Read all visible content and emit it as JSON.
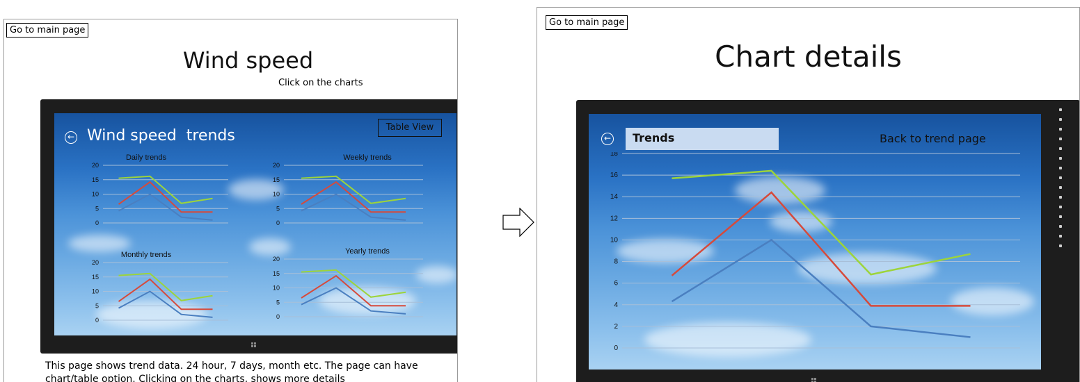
{
  "left": {
    "goto_label": "Go to main page",
    "title": "Wind speed",
    "subtitle": "Click on the charts",
    "app_title": "Wind speed  trends",
    "table_view_label": "Table View",
    "description": "This page shows trend data. 24 hour, 7 days, month etc. The page can have chart/table option. Clicking on the charts, shows more details"
  },
  "right": {
    "goto_label": "Go to main page",
    "title": "Chart details",
    "trends_label": "Trends",
    "back_link_label": "Back to trend page"
  },
  "colors": {
    "green": "#9dd43a",
    "red": "#d64a3b",
    "blue": "#4a7fc0",
    "grid": "#a8bfd8",
    "axis_text": "#111111"
  },
  "icons": [
    "back-arrow-icon",
    "right-arrow-icon",
    "windows-logo-icon"
  ],
  "chart_data": [
    {
      "type": "line",
      "title": "Daily trends",
      "x": [
        1,
        2,
        3,
        4
      ],
      "ylim": [
        0,
        20
      ],
      "yticks": [
        0,
        5,
        10,
        15,
        20
      ],
      "series": [
        {
          "color": "green",
          "values": [
            15.5,
            16.2,
            6.8,
            8.5
          ]
        },
        {
          "color": "red",
          "values": [
            6.5,
            14.2,
            3.8,
            3.8
          ]
        },
        {
          "color": "blue",
          "values": [
            4.2,
            10,
            2,
            1
          ]
        }
      ]
    },
    {
      "type": "line",
      "title": "Weekly trends",
      "x": [
        1,
        2,
        3,
        4
      ],
      "ylim": [
        0,
        20
      ],
      "yticks": [
        0,
        5,
        10,
        15,
        20
      ],
      "series": [
        {
          "color": "green",
          "values": [
            15.5,
            16.2,
            6.8,
            8.5
          ]
        },
        {
          "color": "red",
          "values": [
            6.5,
            14.2,
            3.8,
            3.8
          ]
        },
        {
          "color": "blue",
          "values": [
            4.2,
            10,
            2,
            1
          ]
        }
      ]
    },
    {
      "type": "line",
      "title": "Monthly trends",
      "x": [
        1,
        2,
        3,
        4
      ],
      "ylim": [
        0,
        20
      ],
      "yticks": [
        0,
        5,
        10,
        15,
        20
      ],
      "series": [
        {
          "color": "green",
          "values": [
            15.5,
            16.2,
            6.8,
            8.5
          ]
        },
        {
          "color": "red",
          "values": [
            6.5,
            14.2,
            3.8,
            3.8
          ]
        },
        {
          "color": "blue",
          "values": [
            4.2,
            10,
            2,
            1
          ]
        }
      ]
    },
    {
      "type": "line",
      "title": "Yearly trends",
      "x": [
        1,
        2,
        3,
        4
      ],
      "ylim": [
        0,
        20
      ],
      "yticks": [
        0,
        5,
        10,
        15,
        20
      ],
      "series": [
        {
          "color": "green",
          "values": [
            15.5,
            16.2,
            6.8,
            8.5
          ]
        },
        {
          "color": "red",
          "values": [
            6.5,
            14.2,
            3.8,
            3.8
          ]
        },
        {
          "color": "blue",
          "values": [
            4.2,
            10,
            2,
            1
          ]
        }
      ]
    },
    {
      "type": "line",
      "title": "",
      "x": [
        1,
        2,
        3,
        4
      ],
      "ylim": [
        0,
        18
      ],
      "yticks": [
        0,
        2,
        4,
        6,
        8,
        10,
        12,
        14,
        16,
        18
      ],
      "series": [
        {
          "color": "green",
          "values": [
            15.7,
            16.4,
            6.8,
            8.7
          ]
        },
        {
          "color": "red",
          "values": [
            6.7,
            14.4,
            3.9,
            3.9
          ]
        },
        {
          "color": "blue",
          "values": [
            4.3,
            10,
            2,
            1
          ]
        }
      ]
    }
  ]
}
